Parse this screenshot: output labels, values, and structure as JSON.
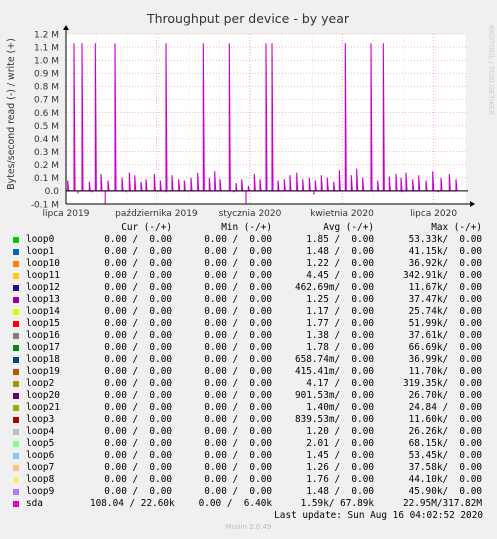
{
  "chart_data": {
    "type": "line",
    "title": "Throughput per device - by year",
    "ylabel": "Bytes/second read (-) / write (+)",
    "watermark": "RRDTOOL / TOBI OETIKER",
    "ylim": [
      -0.1,
      1.2
    ],
    "y_unit": "M",
    "y_ticks": [
      "-0.1 M",
      "0.0",
      "0.1 M",
      "0.2 M",
      "0.3 M",
      "0.4 M",
      "0.5 M",
      "0.6 M",
      "0.7 M",
      "0.8 M",
      "0.9 M",
      "1.0 M",
      "1.1 M",
      "1.2 M"
    ],
    "y_tick_values": [
      -0.1,
      0.0,
      0.1,
      0.2,
      0.3,
      0.4,
      0.5,
      0.6,
      0.7,
      0.8,
      0.9,
      1.0,
      1.1,
      1.2
    ],
    "xlim": [
      0,
      1
    ],
    "x_ticks": [
      "lipca 2019",
      "października 2019",
      "stycznia 2020",
      "kwietnia 2020",
      "lipca 2020"
    ],
    "x_tick_positions": [
      0.0,
      0.226,
      0.46,
      0.69,
      0.919
    ],
    "grid": true,
    "series": [
      {
        "name": "sda",
        "color": "#cc00cc",
        "write_points": [
          [
            0.005,
            0.08
          ],
          [
            0.024,
            1.13
          ],
          [
            0.048,
            1.13
          ],
          [
            0.07,
            0.07
          ],
          [
            0.088,
            1.13
          ],
          [
            0.105,
            0.13
          ],
          [
            0.126,
            0.08
          ],
          [
            0.147,
            1.13
          ],
          [
            0.168,
            0.1
          ],
          [
            0.19,
            0.14
          ],
          [
            0.206,
            0.12
          ],
          [
            0.225,
            0.07
          ],
          [
            0.24,
            0.09
          ],
          [
            0.265,
            0.13
          ],
          [
            0.283,
            0.08
          ],
          [
            0.3,
            1.13
          ],
          [
            0.318,
            0.12
          ],
          [
            0.338,
            0.09
          ],
          [
            0.355,
            0.08
          ],
          [
            0.375,
            0.1
          ],
          [
            0.395,
            0.14
          ],
          [
            0.412,
            1.13
          ],
          [
            0.43,
            0.1
          ],
          [
            0.446,
            0.15
          ],
          [
            0.462,
            0.09
          ],
          [
            0.49,
            1.13
          ],
          [
            0.51,
            0.06
          ],
          [
            0.527,
            0.09
          ],
          [
            0.547,
            0.04
          ],
          [
            0.565,
            0.13
          ],
          [
            0.582,
            0.09
          ],
          [
            0.6,
            1.13
          ],
          [
            0.618,
            1.13
          ],
          [
            0.636,
            0.08
          ],
          [
            0.655,
            0.09
          ],
          [
            0.672,
            0.12
          ],
          [
            0.692,
            0.14
          ],
          [
            0.71,
            0.09
          ],
          [
            0.73,
            0.1
          ],
          [
            0.748,
            0.08
          ],
          [
            0.766,
            0.12
          ],
          [
            0.784,
            0.1
          ],
          [
            0.803,
            0.07
          ],
          [
            0.82,
            0.16
          ],
          [
            0.838,
            1.13
          ],
          [
            0.856,
            0.12
          ],
          [
            0.872,
            0.17
          ],
          [
            0.89,
            0.1
          ],
          [
            0.915,
            1.13
          ],
          [
            0.935,
            0.08
          ],
          [
            0.952,
            1.13
          ],
          [
            0.97,
            0.11
          ],
          [
            0.99,
            0.13
          ],
          [
            1.005,
            0.1
          ],
          [
            1.02,
            0.14
          ],
          [
            1.04,
            0.09
          ],
          [
            1.058,
            0.12
          ],
          [
            1.08,
            0.08
          ],
          [
            1.1,
            0.15
          ],
          [
            1.125,
            0.1
          ],
          [
            1.15,
            0.13
          ],
          [
            1.17,
            0.09
          ]
        ],
        "read_points": [
          [
            0.005,
            -0.005
          ],
          [
            0.03,
            -0.02
          ],
          [
            0.065,
            -0.01
          ],
          [
            0.098,
            -0.1
          ],
          [
            0.15,
            -0.01
          ],
          [
            0.25,
            -0.01
          ],
          [
            0.42,
            -0.01
          ],
          [
            0.45,
            -0.1
          ],
          [
            0.62,
            -0.03
          ],
          [
            0.84,
            -0.01
          ],
          [
            0.93,
            -0.01
          ]
        ]
      }
    ],
    "legend_header": {
      "cur": "Cur (-/+)",
      "min": "Min (-/+)",
      "avg": "Avg (-/+)",
      "max": "Max (-/+)"
    },
    "legend": [
      {
        "name": "loop0",
        "color": "#00cc00",
        "cur": "0.00 /  0.00",
        "min": "0.00 /  0.00",
        "avg": "1.85 /  0.00",
        "max": "53.33k/  0.00"
      },
      {
        "name": "loop1",
        "color": "#0066b3",
        "cur": "0.00 /  0.00",
        "min": "0.00 /  0.00",
        "avg": "1.48 /  0.00",
        "max": "41.15k/  0.00"
      },
      {
        "name": "loop10",
        "color": "#ff8000",
        "cur": "0.00 /  0.00",
        "min": "0.00 /  0.00",
        "avg": "1.22 /  0.00",
        "max": "36.92k/  0.00"
      },
      {
        "name": "loop11",
        "color": "#ffcc00",
        "cur": "0.00 /  0.00",
        "min": "0.00 /  0.00",
        "avg": "4.45 /  0.00",
        "max": "342.91k/  0.00"
      },
      {
        "name": "loop12",
        "color": "#330099",
        "cur": "0.00 /  0.00",
        "min": "0.00 /  0.00",
        "avg": "462.69m/  0.00",
        "max": "11.67k/  0.00"
      },
      {
        "name": "loop13",
        "color": "#990099",
        "cur": "0.00 /  0.00",
        "min": "0.00 /  0.00",
        "avg": "1.25 /  0.00",
        "max": "37.47k/  0.00"
      },
      {
        "name": "loop14",
        "color": "#ccff00",
        "cur": "0.00 /  0.00",
        "min": "0.00 /  0.00",
        "avg": "1.17 /  0.00",
        "max": "25.74k/  0.00"
      },
      {
        "name": "loop15",
        "color": "#ff0000",
        "cur": "0.00 /  0.00",
        "min": "0.00 /  0.00",
        "avg": "1.77 /  0.00",
        "max": "51.99k/  0.00"
      },
      {
        "name": "loop16",
        "color": "#808080",
        "cur": "0.00 /  0.00",
        "min": "0.00 /  0.00",
        "avg": "1.38 /  0.00",
        "max": "37.61k/  0.00"
      },
      {
        "name": "loop17",
        "color": "#008f00",
        "cur": "0.00 /  0.00",
        "min": "0.00 /  0.00",
        "avg": "1.78 /  0.00",
        "max": "66.69k/  0.00"
      },
      {
        "name": "loop18",
        "color": "#00487d",
        "cur": "0.00 /  0.00",
        "min": "0.00 /  0.00",
        "avg": "658.74m/  0.00",
        "max": "36.99k/  0.00"
      },
      {
        "name": "loop19",
        "color": "#b35a00",
        "cur": "0.00 /  0.00",
        "min": "0.00 /  0.00",
        "avg": "415.41m/  0.00",
        "max": "11.70k/  0.00"
      },
      {
        "name": "loop2",
        "color": "#b38f00",
        "cur": "0.00 /  0.00",
        "min": "0.00 /  0.00",
        "avg": "4.17 /  0.00",
        "max": "319.35k/  0.00"
      },
      {
        "name": "loop20",
        "color": "#6b006b",
        "cur": "0.00 /  0.00",
        "min": "0.00 /  0.00",
        "avg": "901.53m/  0.00",
        "max": "26.70k/  0.00"
      },
      {
        "name": "loop21",
        "color": "#8fb300",
        "cur": "0.00 /  0.00",
        "min": "0.00 /  0.00",
        "avg": "1.40m/  0.00",
        "max": "24.84 /  0.00"
      },
      {
        "name": "loop3",
        "color": "#b30000",
        "cur": "0.00 /  0.00",
        "min": "0.00 /  0.00",
        "avg": "839.53m/  0.00",
        "max": "11.60k/  0.00"
      },
      {
        "name": "loop4",
        "color": "#bebebe",
        "cur": "0.00 /  0.00",
        "min": "0.00 /  0.00",
        "avg": "1.20 /  0.00",
        "max": "26.26k/  0.00"
      },
      {
        "name": "loop5",
        "color": "#80ff80",
        "cur": "0.00 /  0.00",
        "min": "0.00 /  0.00",
        "avg": "2.01 /  0.00",
        "max": "68.15k/  0.00"
      },
      {
        "name": "loop6",
        "color": "#80c9ff",
        "cur": "0.00 /  0.00",
        "min": "0.00 /  0.00",
        "avg": "1.45 /  0.00",
        "max": "53.45k/  0.00"
      },
      {
        "name": "loop7",
        "color": "#ffc080",
        "cur": "0.00 /  0.00",
        "min": "0.00 /  0.00",
        "avg": "1.26 /  0.00",
        "max": "37.58k/  0.00"
      },
      {
        "name": "loop8",
        "color": "#ffe680",
        "cur": "0.00 /  0.00",
        "min": "0.00 /  0.00",
        "avg": "1.76 /  0.00",
        "max": "44.10k/  0.00"
      },
      {
        "name": "loop9",
        "color": "#aa80ff",
        "cur": "0.00 /  0.00",
        "min": "0.00 /  0.00",
        "avg": "1.48 /  0.00",
        "max": "45.90k/  0.00"
      },
      {
        "name": "sda",
        "color": "#ee00cc",
        "cur": "108.04 / 22.60k",
        "min": "0.00 /  6.40k",
        "avg": "1.59k/ 67.89k",
        "max": "22.95M/317.82M"
      }
    ],
    "last_update": "Last update: Sun Aug 16 04:02:52 2020",
    "footer": "Munin 2.0.49"
  }
}
